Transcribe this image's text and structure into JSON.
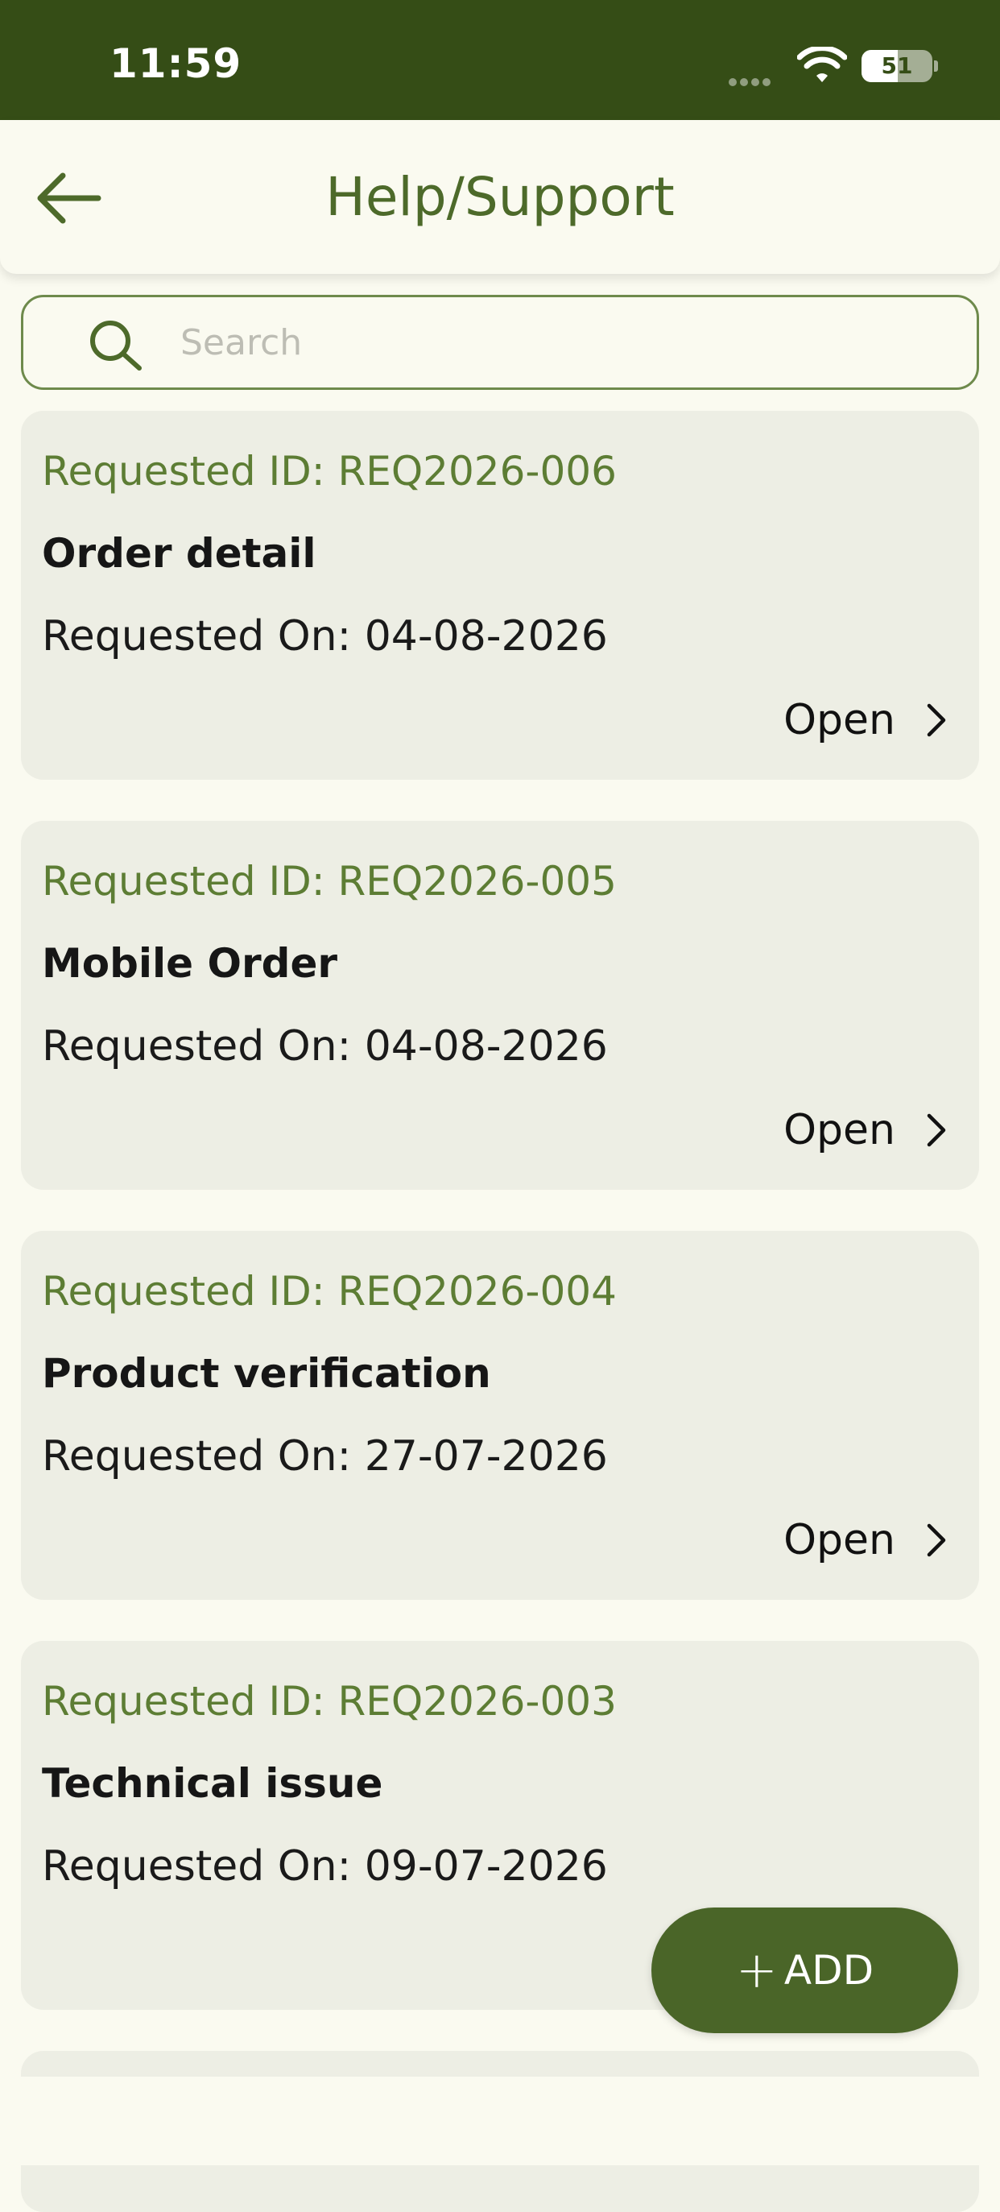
{
  "status_bar": {
    "time": "11:59",
    "battery_level": "51",
    "icons": [
      "signal-dots-icon",
      "wifi-icon",
      "battery-icon"
    ]
  },
  "header": {
    "title": "Help/Support",
    "back_icon": "arrow-left-icon"
  },
  "search": {
    "placeholder": "Search",
    "value": "",
    "icon": "search-icon"
  },
  "requests": [
    {
      "id_label": "Requested ID: REQ2026-006",
      "subject": "Order detail",
      "date_label": "Requested On: 04-08-2026",
      "status": "Open"
    },
    {
      "id_label": "Requested ID: REQ2026-005",
      "subject": "Mobile Order",
      "date_label": "Requested On: 04-08-2026",
      "status": "Open"
    },
    {
      "id_label": "Requested ID: REQ2026-004",
      "subject": "Product verification",
      "date_label": "Requested On: 27-07-2026",
      "status": "Open"
    },
    {
      "id_label": "Requested ID: REQ2026-003",
      "subject": "Technical issue",
      "date_label": "Requested On: 09-07-2026",
      "status": ""
    }
  ],
  "fab": {
    "plus": "+",
    "label": "ADD"
  },
  "colors": {
    "brand_dark": "#354d16",
    "brand": "#4a6528",
    "accent_text": "#5d7d34",
    "background": "#fafaf0",
    "card": "#edeee4"
  }
}
